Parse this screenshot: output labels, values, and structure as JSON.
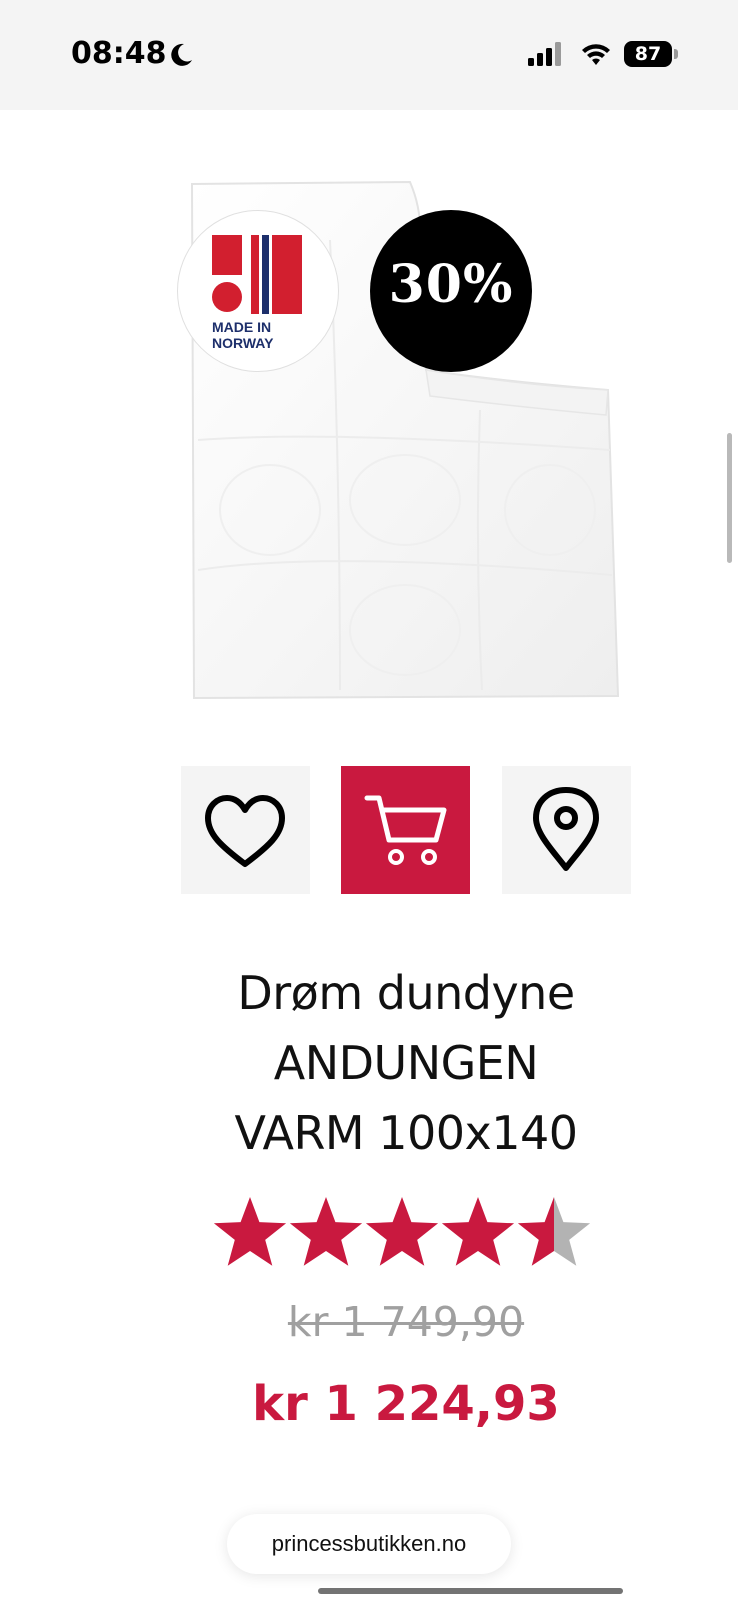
{
  "status_bar": {
    "time": "08:48",
    "battery_level": "87",
    "icons": [
      "moon-icon",
      "signal-icon",
      "wifi-icon",
      "battery-icon"
    ]
  },
  "badges": {
    "made_in": "MADE IN",
    "norway": "NORWAY",
    "discount": "30%"
  },
  "actions": {
    "favorite_icon": "heart-icon",
    "cart_icon": "cart-icon",
    "store_icon": "location-pin-icon"
  },
  "product": {
    "title_line1": "Drøm dundyne",
    "title_line2": "ANDUNGEN",
    "title_line3": "VARM 100x140",
    "rating": 4.5,
    "rating_max": 5,
    "old_price": "kr 1 749,90",
    "new_price": "kr 1 224,93"
  },
  "browser": {
    "url": "princessbutikken.no"
  },
  "colors": {
    "accent": "#c9193f",
    "star_empty": "#b3b3b3",
    "norway_red": "#d21f2f",
    "norway_blue": "#1d2f6b"
  }
}
